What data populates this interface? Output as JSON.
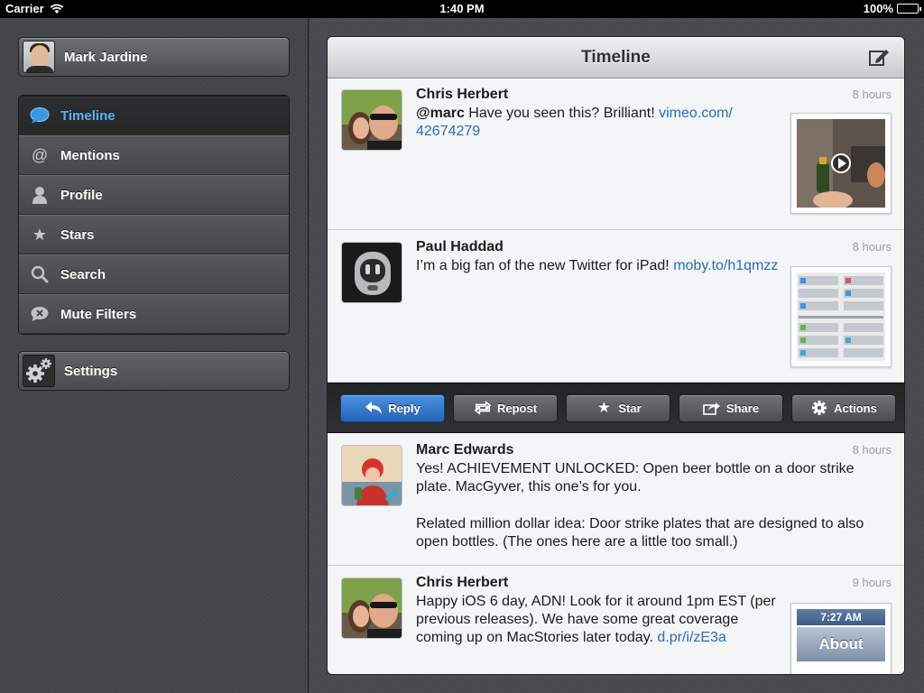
{
  "status_bar": {
    "carrier": "Carrier",
    "time": "1:40 PM",
    "battery": "100%",
    "battery_level": 1.0
  },
  "sidebar": {
    "account": {
      "name": "Mark Jardine"
    },
    "nav": [
      {
        "label": "Timeline",
        "icon": "speech-bubble-icon",
        "active": true
      },
      {
        "label": "Mentions",
        "icon": "at-sign-icon",
        "active": false
      },
      {
        "label": "Profile",
        "icon": "person-icon",
        "active": false
      },
      {
        "label": "Stars",
        "icon": "star-icon",
        "active": false
      },
      {
        "label": "Search",
        "icon": "magnifier-icon",
        "active": false
      },
      {
        "label": "Mute Filters",
        "icon": "mute-bubble-icon",
        "active": false
      }
    ],
    "settings": {
      "label": "Settings",
      "icon": "gears-icon"
    }
  },
  "timeline": {
    "title": "Timeline",
    "posts": [
      {
        "author": "Chris Herbert",
        "time": "8 hours",
        "mention": "@marc",
        "text": " Have you seen this? Brilliant! ",
        "link": "vimeo.com/ 42674279",
        "thumb": "video-thumbnail"
      },
      {
        "author": "Paul Haddad",
        "time": "8 hours",
        "text": "I’m a big fan of the new Twitter for iPad! ",
        "link": "moby.to/h1qmzz",
        "thumb": "screenshot-thumbnail"
      },
      {
        "author": "Marc Edwards",
        "time": "8 hours",
        "text": "Yes! ACHIEVEMENT UNLOCKED: Open beer bottle on a door strike plate. MacGyver, this one’s for you.",
        "text2": "Related million dollar idea: Door strike plates that are designed to also open bottles. (The ones here are a little too small.)"
      },
      {
        "author": "Chris Herbert",
        "time": "9 hours",
        "text": "Happy iOS 6 day, ADN! Look for it around 1pm EST (per previous releases). We have some great coverage coming up on MacStories later today. ",
        "link": "d.pr/i/zE3a",
        "thumb_time": "7:27 AM",
        "thumb_label": "About"
      }
    ],
    "actions": [
      {
        "label": "Reply",
        "icon": "reply-arrow-icon"
      },
      {
        "label": "Repost",
        "icon": "repost-arrows-icon"
      },
      {
        "label": "Star",
        "icon": "star-icon"
      },
      {
        "label": "Share",
        "icon": "share-box-icon"
      },
      {
        "label": "Actions",
        "icon": "gear-icon"
      }
    ]
  },
  "colors": {
    "accent": "#5cb2ee",
    "link": "#2a6db6",
    "reply_button": "#2463b8"
  }
}
